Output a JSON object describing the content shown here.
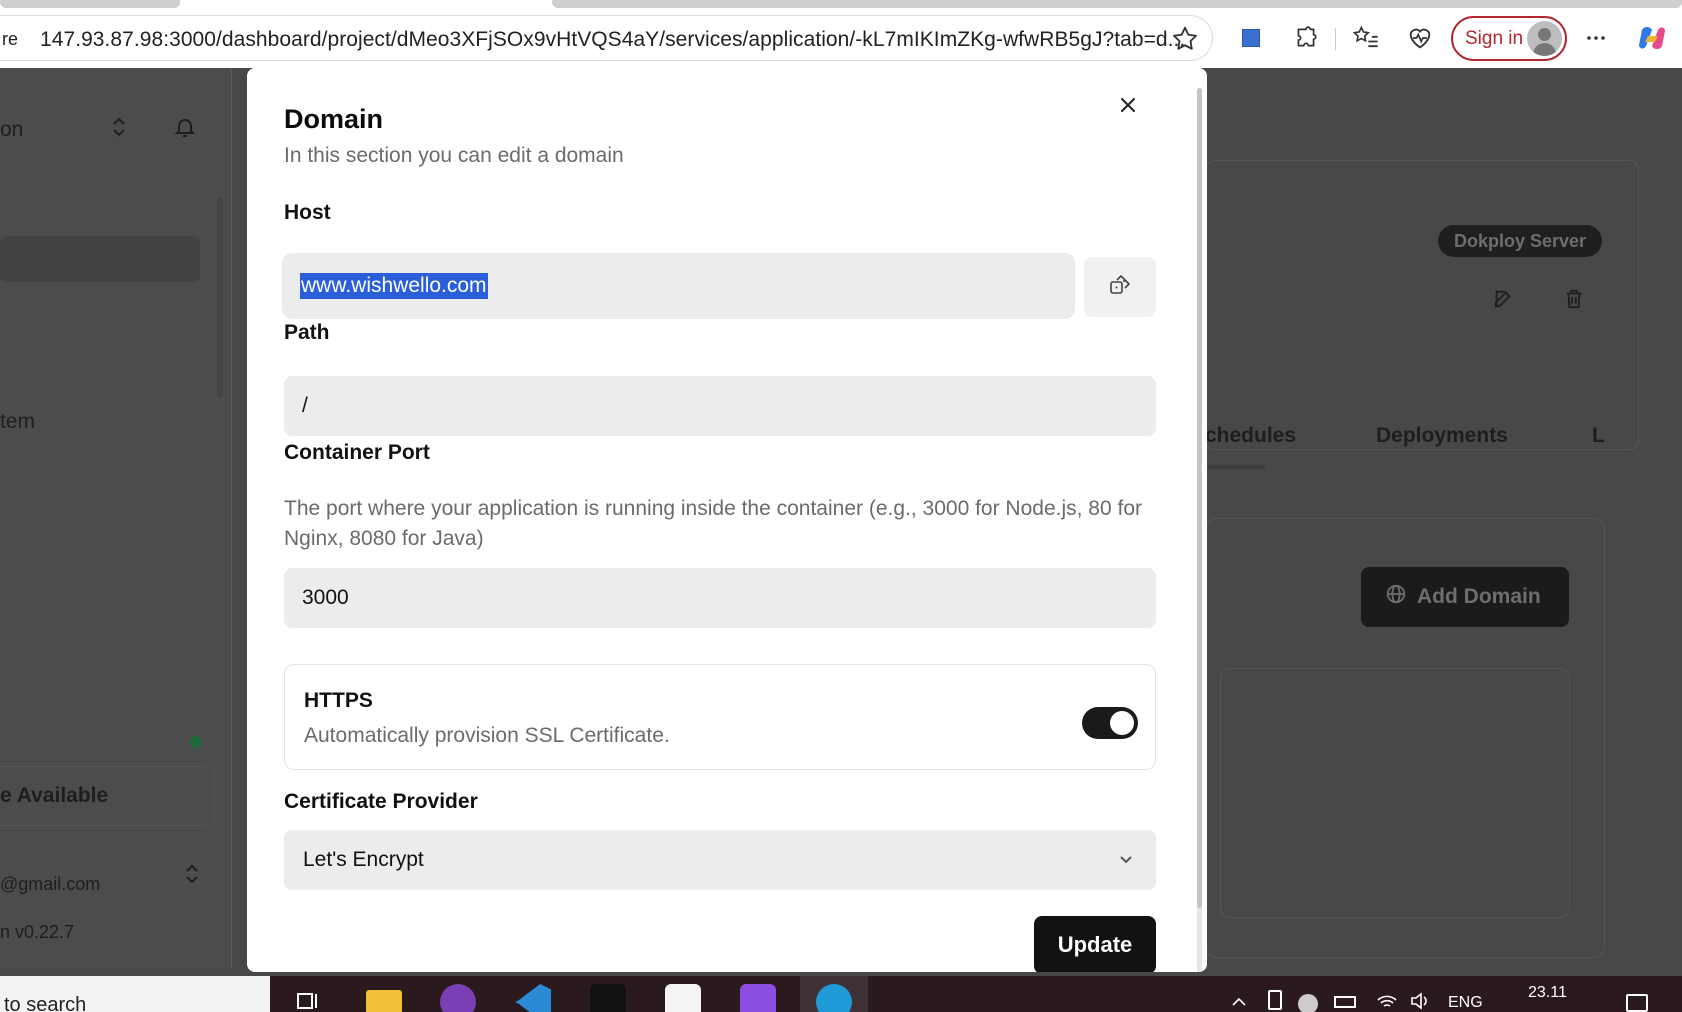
{
  "browser": {
    "address_prefix": "re",
    "url": "147.93.87.98:3000/dashboard/project/dMeo3XFjSOx9vHtVQS4aY/services/application/-kL7mIKImZKg-wfwRB5gJ?tab=d...",
    "signin_label": "Sign in"
  },
  "background_page": {
    "sidebar_fragments": [
      "on",
      "tem",
      "e Available",
      "@gmail.com",
      "n v0.22.7"
    ],
    "server_badge": "Dokploy Server",
    "tabs": [
      "chedules",
      "Deployments",
      "L"
    ],
    "add_domain_label": "Add Domain"
  },
  "modal": {
    "title": "Domain",
    "description": "In this section you can edit a domain",
    "host": {
      "label": "Host",
      "value": "www.wishwello.com"
    },
    "path": {
      "label": "Path",
      "value": "/"
    },
    "container_port": {
      "label": "Container Port",
      "help": "The port where your application is running inside the container (e.g., 3000 for Node.js, 80 for Nginx, 8080 for Java)",
      "value": "3000"
    },
    "https": {
      "title": "HTTPS",
      "description": "Automatically provision SSL Certificate.",
      "enabled": true
    },
    "certificate_provider": {
      "label": "Certificate Provider",
      "selected": "Let's Encrypt"
    },
    "update_label": "Update"
  },
  "taskbar": {
    "search_text": "to search",
    "language": "ENG",
    "time": "23.11"
  }
}
